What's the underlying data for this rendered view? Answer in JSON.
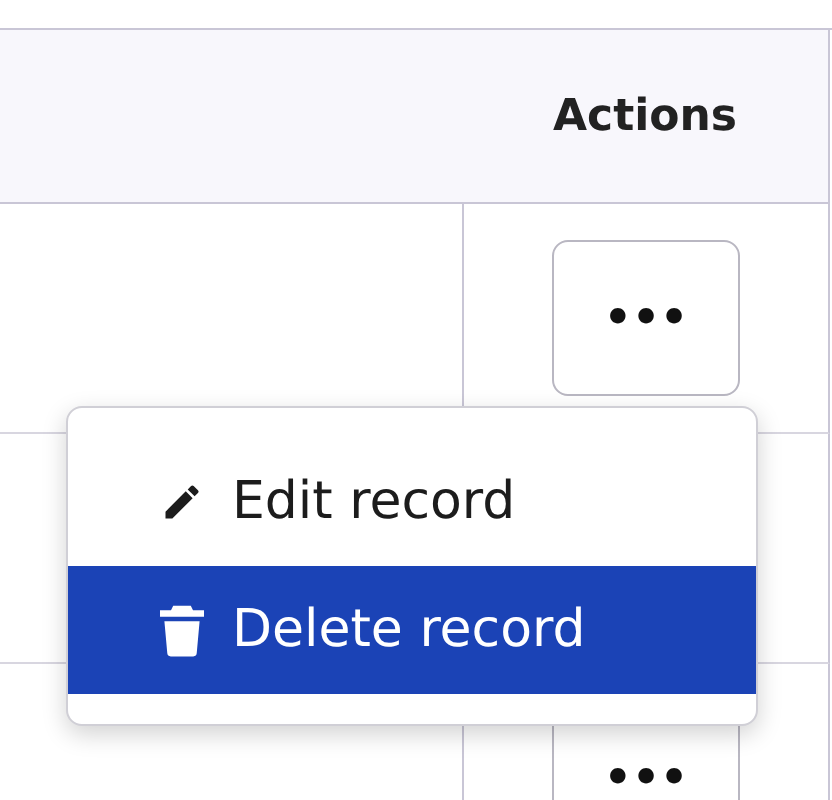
{
  "table": {
    "columns": [
      {},
      {
        "label": "Actions"
      }
    ],
    "rows": [
      {
        "action": "•••"
      },
      {},
      {
        "action": "•••"
      }
    ]
  },
  "menu": {
    "items": [
      {
        "label": "Edit record",
        "kind": "edit",
        "selected": false
      },
      {
        "label": "Delete record",
        "kind": "delete",
        "selected": true
      }
    ]
  }
}
